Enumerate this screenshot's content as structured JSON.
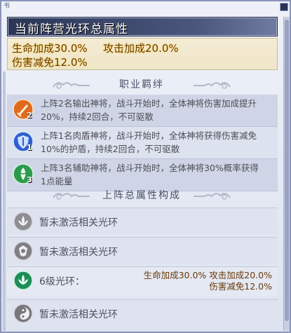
{
  "window": {
    "corner_mark": "书"
  },
  "panel": {
    "title": "当前阵营光环总属性"
  },
  "total_stats": {
    "line1_a": "生命加成30.0%",
    "line1_b": "攻击加成20.0%",
    "line2": "伤害减免12.0%"
  },
  "synergy_section": {
    "heading": "职业羁绊",
    "items": [
      {
        "icon": "sword-class-icon",
        "badge": "2",
        "line1": "上阵2名输出神将，战斗开始时，全体神将伤害加成提升",
        "line2": "20%，持续2回合，不可驱散"
      },
      {
        "icon": "shield-class-icon",
        "badge": "1",
        "line1": "上阵1名肉盾神将，战斗开始时，全体神将获得伤害减免",
        "line2": "10%的护盾，持续2回合，不可驱散"
      },
      {
        "icon": "support-class-icon",
        "badge": "3",
        "line1": "上阵3名辅助神将，战斗开始时，全体神将30%概率获得",
        "line2": "1点能量"
      }
    ]
  },
  "aura_section": {
    "heading": "上阵总属性构成",
    "rows": [
      {
        "icon": "lotus-aura-icon",
        "text": "暂未激活相关光环"
      },
      {
        "icon": "crest-aura-icon",
        "text": "暂未激活相关光环"
      },
      {
        "icon": "green-lotus-aura-icon",
        "text": "6级光环：",
        "stats_line1": "生命加成30.0% 攻击加成20.0%",
        "stats_line2": "伤害减免12.0%"
      },
      {
        "icon": "yinyang-aura-icon",
        "text": "暂未激活相关光环"
      }
    ]
  },
  "colors": {
    "title_bar": "#2b3556",
    "stat_text": "#6b3a08",
    "stat_glow": "#ffe07a",
    "panel_bg": "#dde3f0"
  }
}
